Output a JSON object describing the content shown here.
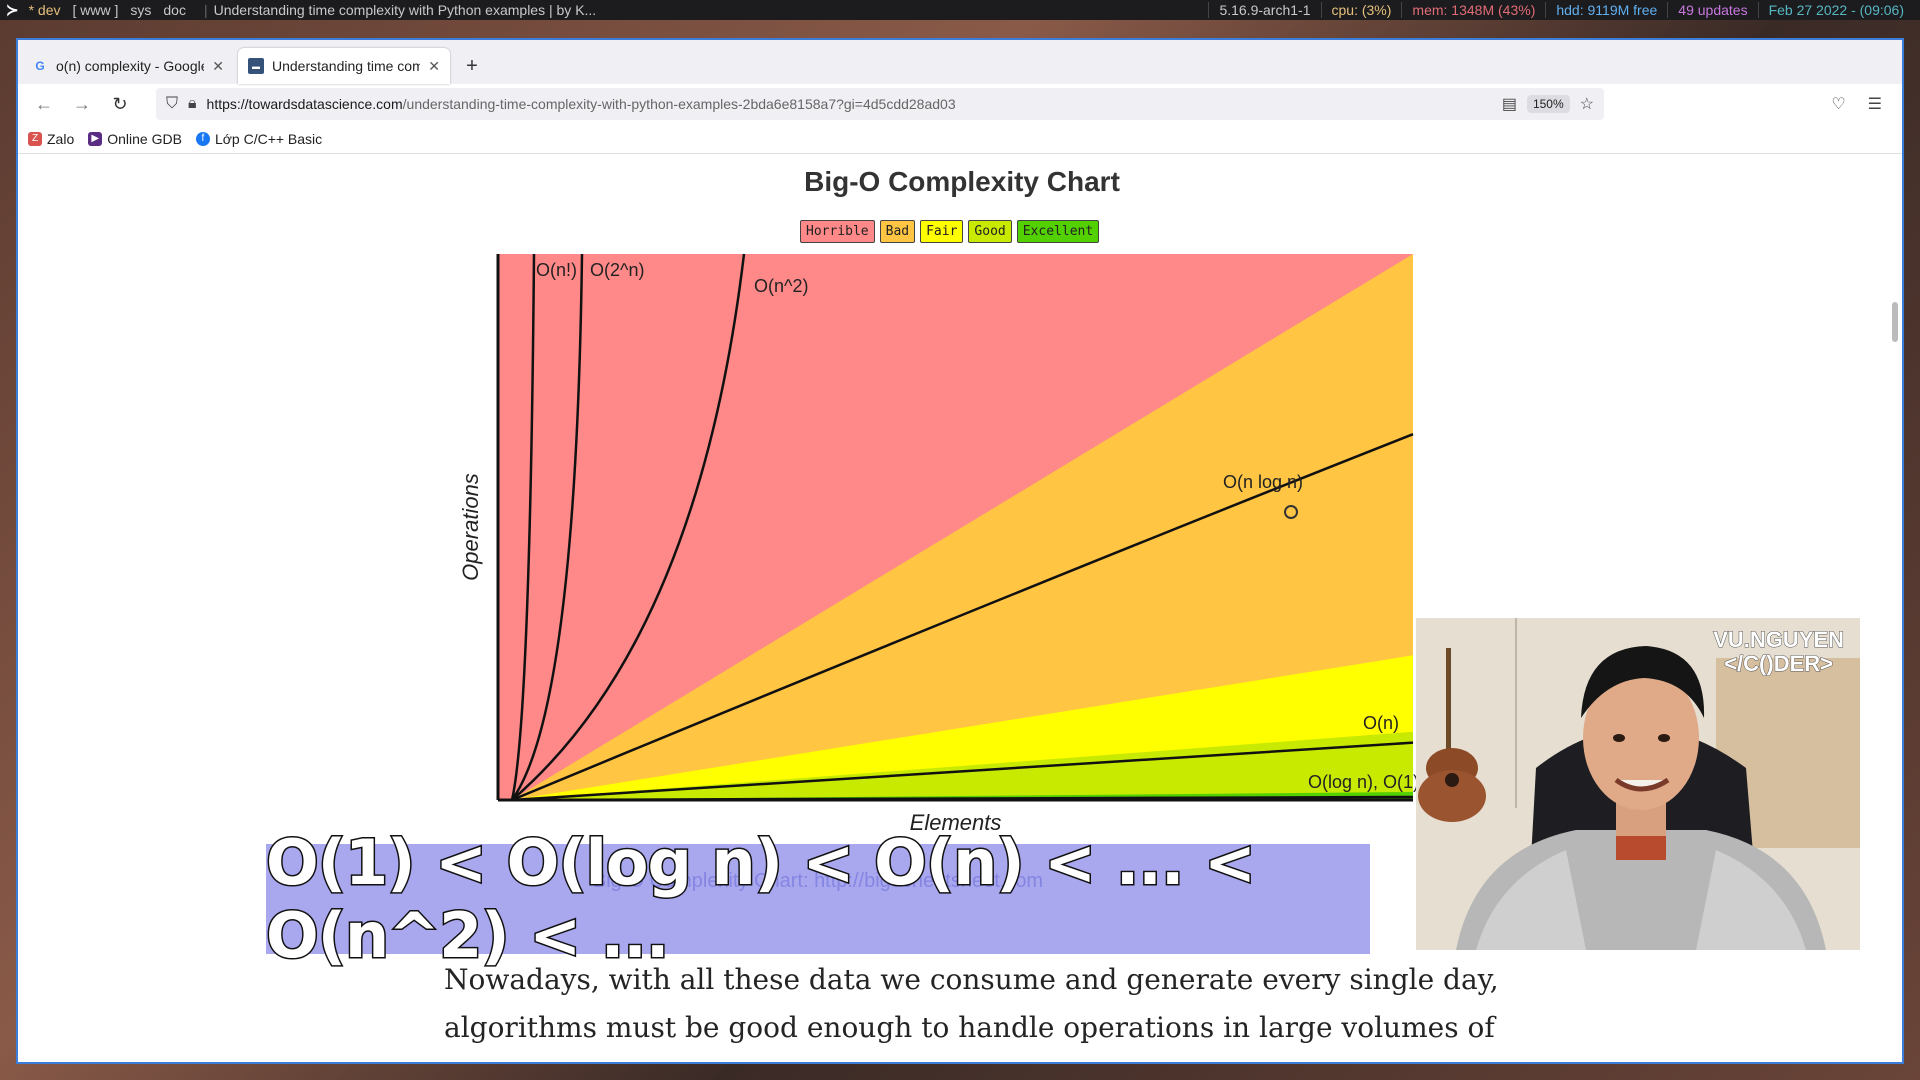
{
  "statusbar": {
    "workspaces": [
      "* dev",
      "[ www ]",
      "sys",
      "doc"
    ],
    "window_title": "Understanding time complexity with Python examples | by K...",
    "kernel": "5.16.9-arch1-1",
    "cpu": "cpu: (3%)",
    "mem": "mem: 1348M (43%)",
    "hdd": "hdd: 9119M free",
    "updates": "49 updates",
    "datetime": "Feb 27 2022 - (09:06)"
  },
  "browser": {
    "tabs": [
      {
        "label": "o(n) complexity - Google",
        "icon": "google-icon"
      },
      {
        "label": "Understanding time comp",
        "icon": "tds-icon"
      }
    ],
    "url_domain": "https://towardsdatascience.com",
    "url_path": "/understanding-time-complexity-with-python-examples-2bda6e8158a7?gi=4d5cdd28ad03",
    "zoom": "150%",
    "bookmarks": [
      "Zalo",
      "Online GDB",
      "Lớp C/C++ Basic"
    ]
  },
  "chart": {
    "title": "Big-O Complexity Chart",
    "legend": [
      {
        "label": "Horrible",
        "color": "#ff8989"
      },
      {
        "label": "Bad",
        "color": "#ffc543"
      },
      {
        "label": "Fair",
        "color": "#ffff00"
      },
      {
        "label": "Good",
        "color": "#c8ea00"
      },
      {
        "label": "Excellent",
        "color": "#53d000"
      }
    ],
    "xlabel": "Elements",
    "ylabel": "Operations"
  },
  "chart_data": {
    "type": "line",
    "title": "Big-O Complexity Chart",
    "xlabel": "Elements",
    "ylabel": "Operations",
    "series": [
      {
        "name": "O(n!)"
      },
      {
        "name": "O(2^n)"
      },
      {
        "name": "O(n^2)"
      },
      {
        "name": "O(n log n)"
      },
      {
        "name": "O(n)"
      },
      {
        "name": "O(log n), O(1)"
      }
    ],
    "regions": [
      "Horrible",
      "Bad",
      "Fair",
      "Good",
      "Excellent"
    ],
    "grid": false,
    "legend_position": "top"
  },
  "article": {
    "caption_partial": "Big-O Complexity Chart: http://bigocheatsheet.com",
    "lines": [
      "Nowadays, with all these data we consume and generate every single day,",
      "algorithms must be good enough to handle operations in large volumes of"
    ]
  },
  "overlay": {
    "caption": "O(1) < O(log n) < O(n) < ... < O(n^2) < ...",
    "webcam_brand_line1": "VU.NGUYEN",
    "webcam_brand_line2": "</C()DER>"
  }
}
